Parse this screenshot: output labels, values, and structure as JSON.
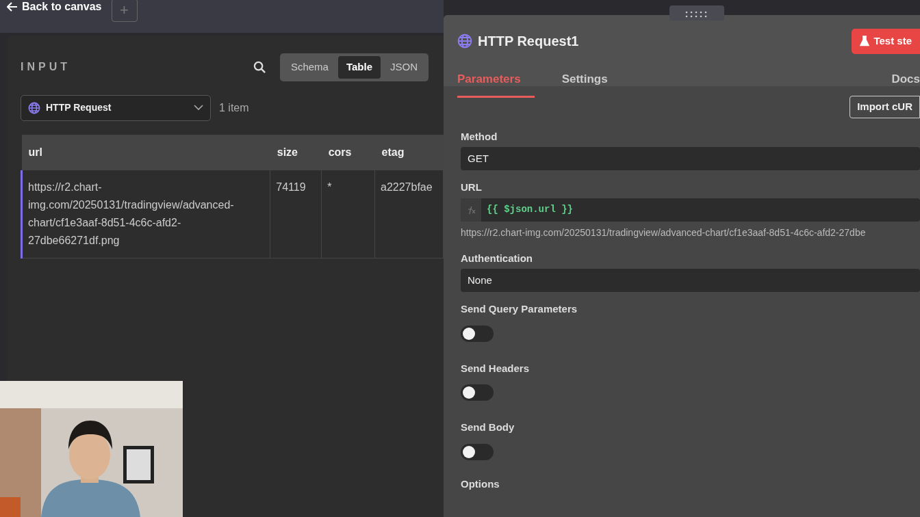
{
  "top_bar": {
    "back_link": "Back to canvas",
    "add_button": "+"
  },
  "input_panel": {
    "title": "INPUT",
    "view_tabs": [
      {
        "label": "Schema",
        "selected": false
      },
      {
        "label": "Table",
        "selected": true
      },
      {
        "label": "JSON",
        "selected": false
      }
    ],
    "node_select": "HTTP Request",
    "item_count": "1 item",
    "table": {
      "columns": [
        "url",
        "size",
        "cors",
        "etag"
      ],
      "rows": [
        [
          "https://r2.chart-img.com/20250131/tradingview/advanced-chart/cf1e3aaf-8d51-4c6c-afd2-27dbe66271df.png",
          "74119",
          "*",
          "a2227bfae"
        ]
      ]
    }
  },
  "node_panel": {
    "title": "HTTP Request1",
    "test_button": "Test ste",
    "tabs": [
      {
        "label": "Parameters",
        "selected": true
      },
      {
        "label": "Settings",
        "selected": false
      }
    ],
    "docs_link": "Docs",
    "import_button": "Import cUR",
    "fields": [
      {
        "kind": "select",
        "label": "Method",
        "value": "GET"
      },
      {
        "kind": "expression",
        "label": "URL",
        "value": "{{ $json.url }}",
        "preview": "https://r2.chart-img.com/20250131/tradingview/advanced-chart/cf1e3aaf-8d51-4c6c-afd2-27dbe"
      },
      {
        "kind": "select",
        "label": "Authentication",
        "value": "None"
      },
      {
        "kind": "toggle",
        "label": "Send Query Parameters",
        "on": false
      },
      {
        "kind": "toggle",
        "label": "Send Headers",
        "on": false
      },
      {
        "kind": "toggle",
        "label": "Send Body",
        "on": false
      },
      {
        "kind": "heading",
        "label": "Options"
      }
    ]
  }
}
